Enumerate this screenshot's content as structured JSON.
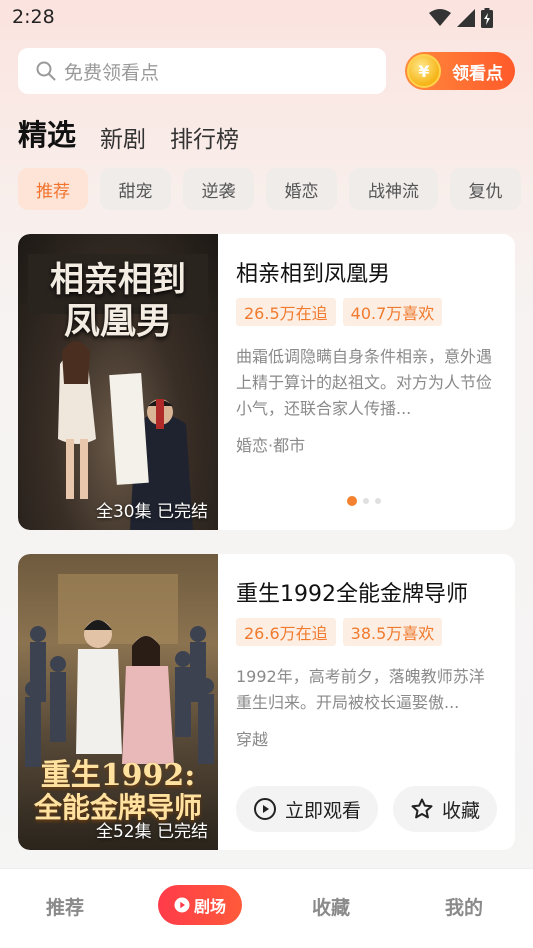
{
  "status": {
    "time": "2:28"
  },
  "search": {
    "placeholder": "免费领看点"
  },
  "coin_button": {
    "coin_glyph": "¥",
    "label": "领看点"
  },
  "top_tabs": [
    {
      "label": "精选",
      "active": true
    },
    {
      "label": "新剧",
      "active": false
    },
    {
      "label": "排行榜",
      "active": false
    }
  ],
  "chips": [
    {
      "label": "推荐",
      "active": true
    },
    {
      "label": "甜宠"
    },
    {
      "label": "逆袭"
    },
    {
      "label": "婚恋"
    },
    {
      "label": "战神流"
    },
    {
      "label": "复仇"
    }
  ],
  "cards": [
    {
      "poster_title_line1": "相亲相到",
      "poster_title_line2": "凤凰男",
      "episodes": "全30集 已完结",
      "title": "相亲相到凤凰男",
      "followers": "26.5万在追",
      "likes": "40.7万喜欢",
      "description": "曲霜低调隐瞒自身条件相亲，意外遇上精于算计的赵祖文。对方为人节俭小气，还联合家人传播...",
      "genre": "婚恋·都市"
    },
    {
      "poster_title_line1": "重生1992:",
      "poster_title_line2": "全能金牌导师",
      "episodes": "全52集 已完结",
      "title": "重生1992全能金牌导师",
      "followers": "26.6万在追",
      "likes": "38.5万喜欢",
      "description": "1992年，高考前夕，落魄教师苏洋重生归来。开局被校长逼娶傲...",
      "genre": "穿越",
      "watch_label": "立即观看",
      "fav_label": "收藏"
    }
  ],
  "bottom_nav": {
    "recommend": "推荐",
    "theater": "剧场",
    "favorites": "收藏",
    "mine": "我的"
  },
  "colors": {
    "accent": "#f2732e",
    "nav_active": "#ff3b4a"
  }
}
